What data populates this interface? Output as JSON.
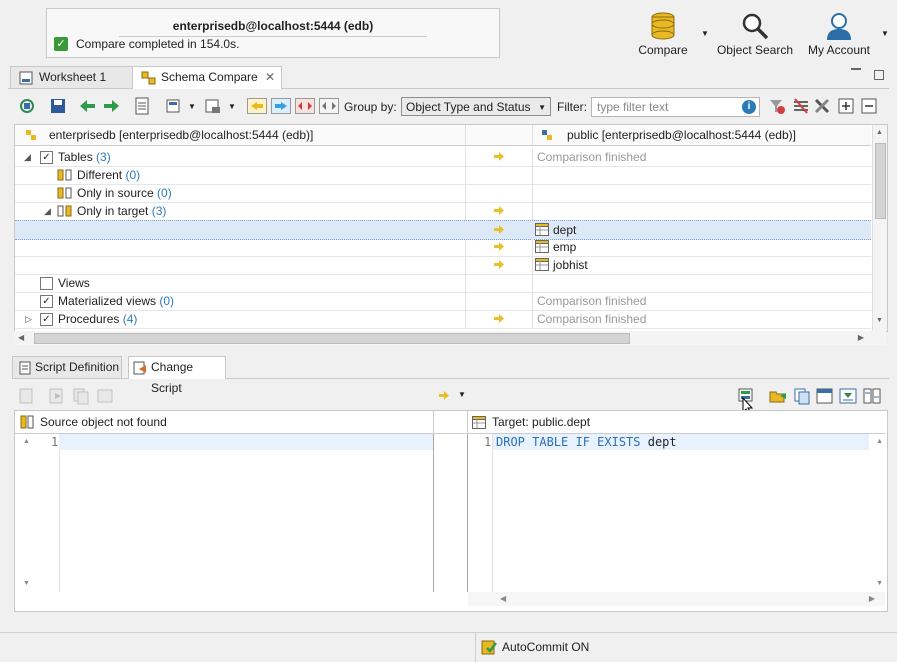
{
  "notification": {
    "title": "enterprisedb@localhost:5444 (edb)",
    "message": "Compare completed in 154.0s."
  },
  "topbar": {
    "compare_label": "Compare",
    "object_search_label": "Object Search",
    "my_account_label": "My Account"
  },
  "tabs": [
    {
      "label": "Worksheet 1"
    },
    {
      "label": "Schema Compare"
    }
  ],
  "toolbar": {
    "group_by_label": "Group by:",
    "group_by_value": "Object Type and Status",
    "filter_label": "Filter:",
    "filter_placeholder": "type filter text"
  },
  "grid": {
    "source_header": "enterprisedb [enterprisedb@localhost:5444 (edb)]",
    "target_header": "public [enterprisedb@localhost:5444 (edb)]",
    "rows": [
      {
        "label": "Tables",
        "count": "(3)",
        "status": "Comparison finished"
      },
      {
        "label": "Different",
        "count": "(0)"
      },
      {
        "label": "Only in source",
        "count": "(0)"
      },
      {
        "label": "Only in target",
        "count": "(3)"
      },
      {
        "target": "dept"
      },
      {
        "target": "emp"
      },
      {
        "target": "jobhist"
      },
      {
        "label": "Views"
      },
      {
        "label": "Materialized views",
        "count": "(0)",
        "status": "Comparison finished"
      },
      {
        "label": "Procedures",
        "count": "(4)",
        "status": "Comparison finished"
      }
    ]
  },
  "bottom_tabs": [
    {
      "label": "Script Definition"
    },
    {
      "label": "Change Script"
    }
  ],
  "script": {
    "source_header": "Source object not found",
    "target_header": "Target: public.dept",
    "source_line_no": "1",
    "target_line_no": "1",
    "target_code_kw": "DROP TABLE IF EXISTS",
    "target_code_name": "dept"
  },
  "status": {
    "autocommit": "AutoCommit ON"
  }
}
